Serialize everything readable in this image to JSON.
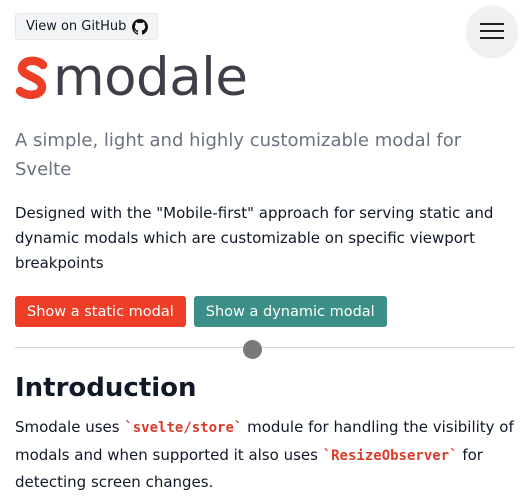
{
  "header": {
    "github_label": "View on GitHub",
    "github_icon": "github-icon",
    "menu_icon": "hamburger-menu-icon"
  },
  "logo": {
    "text": "modale",
    "mark_icon": "svelte-s-icon",
    "colors": {
      "mark": "#ee3e28",
      "text": "#3f3f4a"
    }
  },
  "hero": {
    "tagline": "A simple, light and highly customizable modal for Svelte",
    "description": "Designed with the \"Mobile-first\" approach for serving static and dynamic modals which are customizable on specific viewport breakpoints"
  },
  "actions": {
    "static_label": "Show a static modal",
    "dynamic_label": "Show a dynamic modal",
    "colors": {
      "static": "#ee3e28",
      "dynamic": "#3b8f86"
    }
  },
  "introduction": {
    "title": "Introduction",
    "text_1": "Smodale uses ",
    "code_1": "`svelte/store`",
    "text_2": " module for handling the visibility of modals and when supported it also uses ",
    "code_2": "`ResizeObserver`",
    "text_3": " for detecting screen changes."
  },
  "colors": {
    "accent": "#dc3b2a",
    "muted_text": "#6b7280"
  }
}
